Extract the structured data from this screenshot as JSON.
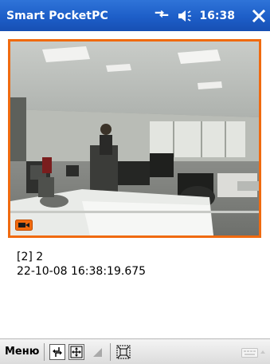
{
  "titlebar": {
    "app_title": "Smart PocketPC",
    "clock": "16:38",
    "icons": [
      "connectivity-icon",
      "speaker-icon",
      "close-icon"
    ]
  },
  "video": {
    "badge_icon": "camera-icon",
    "accent_color": "#f06a0f"
  },
  "info": {
    "camera_label": "[2] 2",
    "timestamp": "22-10-08 16:38:19.675"
  },
  "menubar": {
    "menu_label": "Меню",
    "tools": [
      "swap-arrows-icon",
      "fit-screen-icon",
      "triangle-icon",
      "fullscreen-icon"
    ],
    "keyboard_icon": "keyboard-icon"
  }
}
